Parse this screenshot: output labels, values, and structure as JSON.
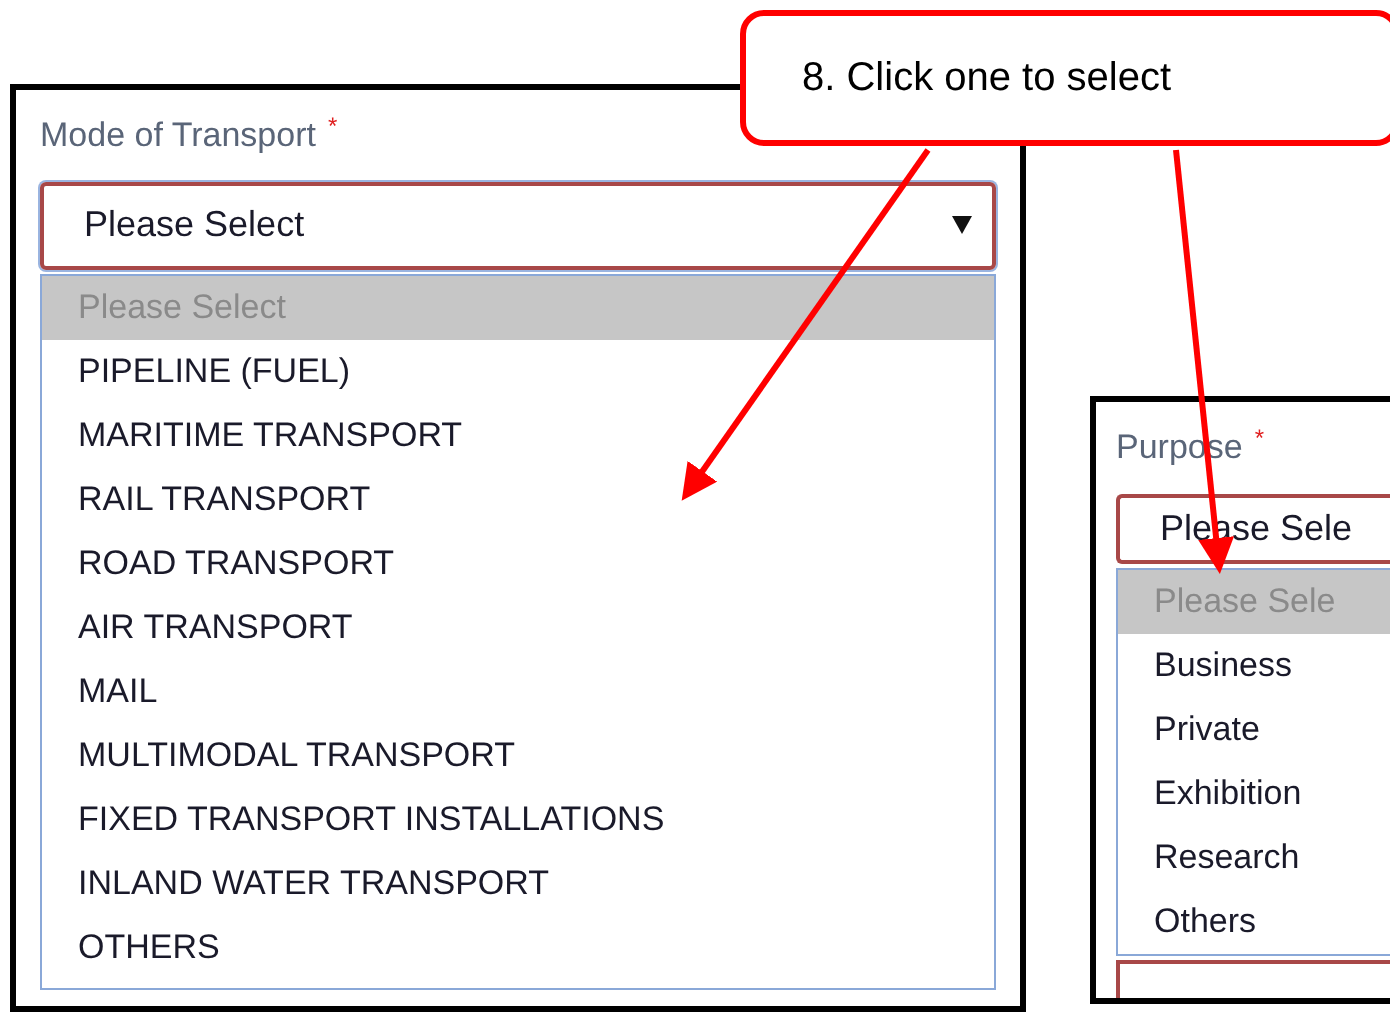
{
  "callout": {
    "text": "8. Click one to select"
  },
  "transport": {
    "label": "Mode of Transport",
    "required_mark": "*",
    "select": {
      "value": "Please Select"
    },
    "options": [
      {
        "label": "Please Select",
        "selected": true
      },
      {
        "label": "PIPELINE (FUEL)",
        "selected": false
      },
      {
        "label": "MARITIME TRANSPORT",
        "selected": false
      },
      {
        "label": "RAIL TRANSPORT",
        "selected": false
      },
      {
        "label": "ROAD TRANSPORT",
        "selected": false
      },
      {
        "label": "AIR TRANSPORT",
        "selected": false
      },
      {
        "label": "MAIL",
        "selected": false
      },
      {
        "label": "MULTIMODAL TRANSPORT",
        "selected": false
      },
      {
        "label": "FIXED TRANSPORT INSTALLATIONS",
        "selected": false
      },
      {
        "label": "INLAND WATER TRANSPORT",
        "selected": false
      },
      {
        "label": "OTHERS",
        "selected": false
      }
    ]
  },
  "purpose": {
    "label": "Purpose",
    "required_mark": "*",
    "select": {
      "value": "Please Sele"
    },
    "options": [
      {
        "label": "Please Sele",
        "selected": true
      },
      {
        "label": "Business",
        "selected": false
      },
      {
        "label": "Private",
        "selected": false
      },
      {
        "label": "Exhibition",
        "selected": false
      },
      {
        "label": "Research",
        "selected": false
      },
      {
        "label": "Others",
        "selected": false
      }
    ]
  }
}
